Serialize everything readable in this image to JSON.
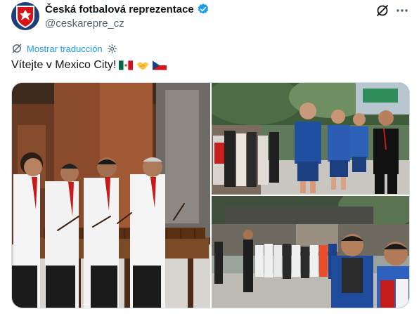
{
  "account": {
    "display_name": "Česká fotbalová reprezentace",
    "handle": "@ceskarepre_cz",
    "verified_icon": "verified-badge-icon",
    "avatar_icon": "crest-icon"
  },
  "actions": {
    "grok_icon": "grok-icon",
    "more_icon": "more-dots-icon"
  },
  "translate": {
    "label": "Mostrar traducción",
    "icon": "translate-icon",
    "settings_icon": "gear-icon"
  },
  "tweet": {
    "text": "Vítejte v Mexico City!",
    "emojis": [
      "mexico-flag",
      "handshake",
      "czech-flag"
    ]
  },
  "media": {
    "photo_count": 3,
    "photos": [
      {
        "name": "marimba-players-photo"
      },
      {
        "name": "team-arrival-photo"
      },
      {
        "name": "fans-welcome-photo"
      }
    ]
  },
  "colors": {
    "accent": "#1d9bf0",
    "text": "#0f1419",
    "secondary": "#536471",
    "border": "#cfd9de"
  }
}
